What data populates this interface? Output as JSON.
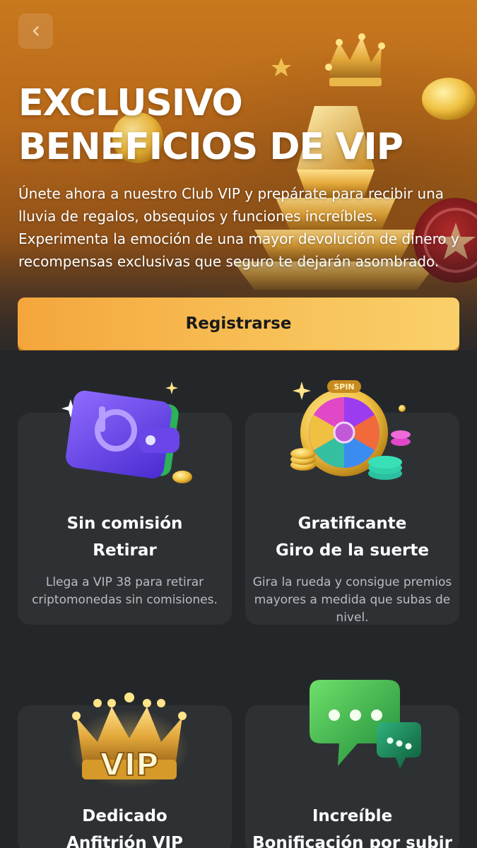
{
  "header": {
    "back_icon": "chevron-left-icon",
    "title_line1": "EXCLUSIVO",
    "title_line2": "BENEFICIOS DE VIP",
    "description": "Únete ahora a nuestro Club VIP y prepárate para recibir una lluvia de regalos, obsequios y funciones increíbles. Experimenta la emoción de una mayor devolución de dinero y recompensas exclusivas que seguro te dejarán asombrado.",
    "register_label": "Registrarse",
    "accent_color": "#f7c158"
  },
  "cards": [
    {
      "icon": "wallet-icon",
      "title_line1": "Sin comisión",
      "title_line2": "Retirar",
      "description": "Llega a VIP 38 para retirar criptomonedas sin comisiones."
    },
    {
      "icon": "spin-wheel-icon",
      "wheel_label": "SPIN",
      "title_line1": "Gratificante",
      "title_line2": "Giro de la suerte",
      "description": "Gira la rueda y consigue premios mayores a medida que subas de nivel."
    },
    {
      "icon": "vip-crown-icon",
      "crown_label": "VIP",
      "title_line1": "Dedicado",
      "title_line2": "Anfitrión VIP"
    },
    {
      "icon": "chat-bubbles-icon",
      "title_line1": "Increíble",
      "title_line2": "Bonificación por subir de"
    }
  ]
}
